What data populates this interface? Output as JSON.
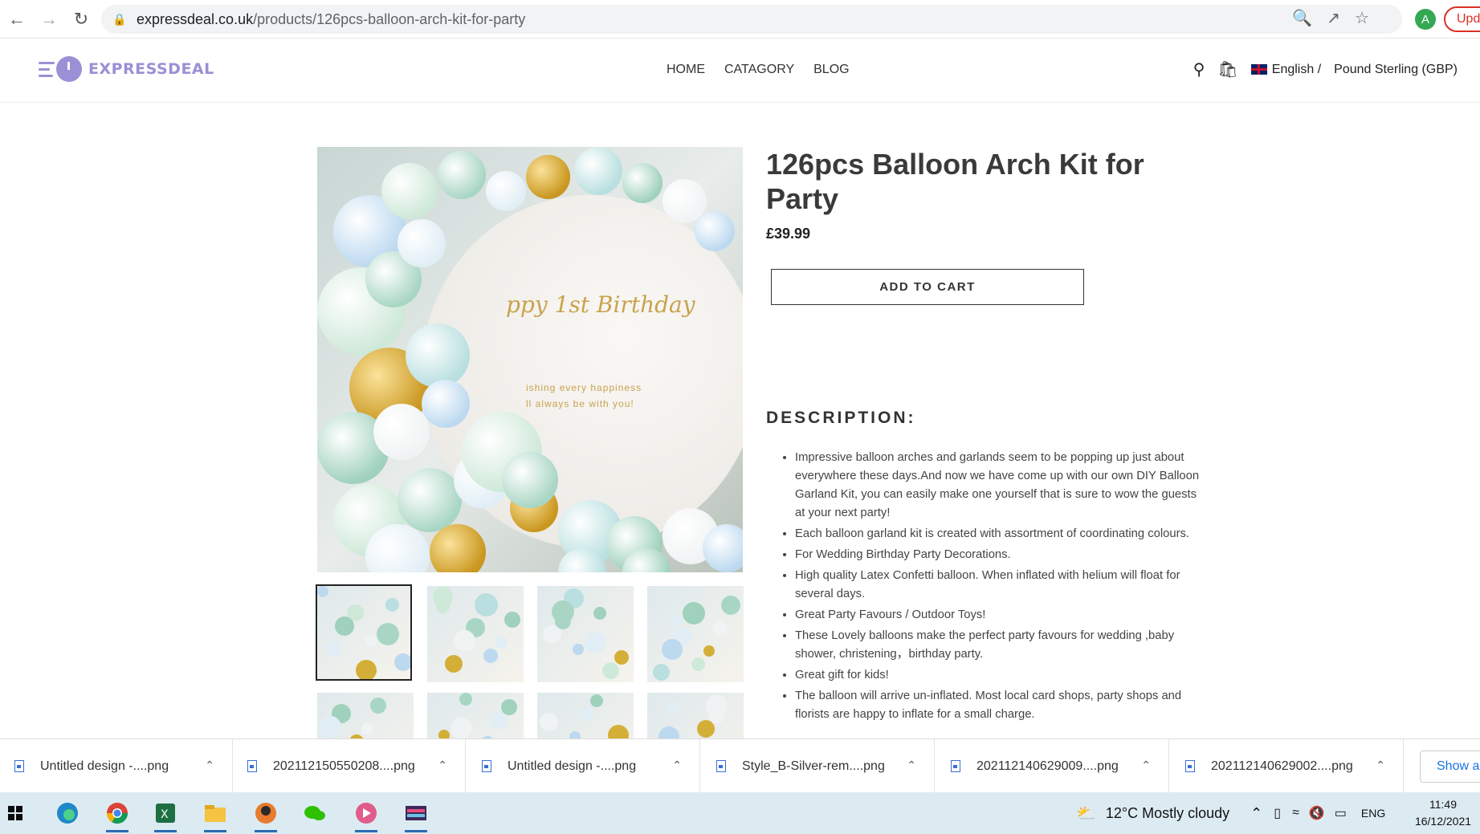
{
  "browser": {
    "url_host": "expressdeal.co.uk",
    "url_path": "/products/126pcs-balloon-arch-kit-for-party",
    "avatar_letter": "A",
    "update_label": "Upd"
  },
  "header": {
    "logo_text": "EXPRESSDEAL",
    "nav": [
      "HOME",
      "CATAGORY",
      "BLOG"
    ],
    "language": "English /",
    "currency": "Pound Sterling (GBP)"
  },
  "product": {
    "title": "126pcs Balloon Arch Kit for Party",
    "price": "£39.99",
    "add_to_cart": "ADD TO CART",
    "hero_text_birthday": "ppy 1st Birthday",
    "hero_text_wish1": "ishing every happiness",
    "hero_text_wish2": "ll always be with you!",
    "description_title": "DESCRIPTION:",
    "description": [
      "Impressive balloon arches and garlands seem to be popping up just about everywhere these days.And  now we have come up with our own DIY Balloon Garland Kit, you can  easily make one yourself that is sure to wow the guests at your next  party!",
      "Each balloon garland kit is created with assortment of coordinating colours.",
      "For Wedding Birthday Party Decorations.",
      "High quality Latex Confetti balloon. When inflated with helium will float for several days.",
      "Great Party Favours / Outdoor Toys!",
      "These Lovely balloons make the perfect party favours for wedding ,baby shower, christening，birthday party.",
      "Great gift for kids!",
      "The balloon will arrive un-inflated. Most local card shops, party shops and florists are happy to inflate for a small charge."
    ]
  },
  "downloads": {
    "items": [
      "Untitled design -....png",
      "202112150550208....png",
      "Untitled design -....png",
      "Style_B-Silver-rem....png",
      "202112140629009....png",
      "202112140629002....png"
    ],
    "show_all": "Show all"
  },
  "taskbar": {
    "weather": "12°C  Mostly cloudy",
    "lang": "ENG",
    "time": "11:49",
    "date": "16/12/2021"
  }
}
